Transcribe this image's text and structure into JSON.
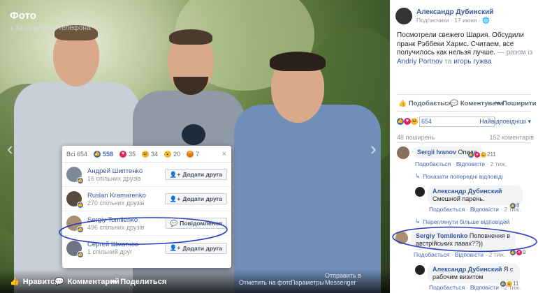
{
  "photo": {
    "title": "Фото",
    "subtitle": "з Загруженнях телефона",
    "bottom": {
      "like": "Нравится",
      "comment": "Комментарий",
      "share": "Поделиться",
      "links": [
        "Отметить на фото",
        "Параметры",
        "Отправить в Messenger"
      ]
    }
  },
  "reactions_popup": {
    "tabs": [
      {
        "label": "Всі 654",
        "icon": "",
        "active": false
      },
      {
        "label": "558",
        "icon": "like-icon",
        "active": true
      },
      {
        "label": "35",
        "icon": "love-icon",
        "active": false
      },
      {
        "label": "34",
        "icon": "haha-icon",
        "active": false
      },
      {
        "label": "20",
        "icon": "wow-icon",
        "active": false
      },
      {
        "label": "7",
        "icon": "angry-icon",
        "active": false
      }
    ],
    "close": "×",
    "people": [
      {
        "name": "Андрей Шиптенко",
        "mutual": "16 спільних друзів",
        "button": "Додати друга",
        "button_icon": "add-friend-icon"
      },
      {
        "name": "Ruslan Kramarenko",
        "mutual": "270 спільних друзів",
        "button": "Додати друга",
        "button_icon": "add-friend-icon"
      },
      {
        "name": "Sergiy Tomilenko",
        "mutual": "496 спільних друзів",
        "button": "Повідомлення",
        "button_icon": "messenger-icon"
      },
      {
        "name": "Сергей Шматков",
        "mutual": "1 спільний друг",
        "button": "Додати друга",
        "button_icon": "add-friend-icon"
      }
    ]
  },
  "post": {
    "author": "Александр Дубинский",
    "meta": "Подписчики · 17 июня · 🌐",
    "text_main": "Посмотрели свежего Шария. Обсудили пранк Рэббеки Хармс. Считаем, все получилось как нельзя лучше.",
    "text_with": " — разом із ",
    "tag1": "Andriy Portnov",
    "text_and": " та ",
    "tag2": "игорь гужва",
    "actions": [
      "Подобається",
      "Коментувати",
      "Поширити"
    ],
    "reaction_count": "654",
    "sort": "Найвідповідніші ▾",
    "shares": "48 поширень",
    "comments_count": "152 коментарів"
  },
  "comments": [
    {
      "name": "Sergii Ivanov",
      "text": "Опида.",
      "meta_like": "Подобається",
      "meta_reply": "Відповісти",
      "meta_time": "2 тиж.",
      "reactions": "211"
    },
    {
      "more": "Показати попередні відповіді"
    },
    {
      "name": "Александр Дубинский",
      "text": "Смешной парень.",
      "meta_like": "Подобається",
      "meta_reply": "Відповісти",
      "meta_time": "2 тиж.",
      "reactions": "8"
    },
    {
      "more": "Переглянути більше відповідей"
    },
    {
      "name": "Sergiy Tomilenko",
      "text": "Поповнення в австрійських лавах??))",
      "meta_like": "Подобається",
      "meta_reply": "Відповісти",
      "meta_time": "2 тиж.",
      "reactions": "9"
    },
    {
      "name": "Александр Дубинский",
      "text": "Я с рабочим визитом",
      "meta_like": "Подобається",
      "meta_reply": "Відповісти",
      "meta_time": "2 тиж.",
      "reactions": "11"
    }
  ],
  "colors": {
    "fb_blue": "#4267b2",
    "link": "#365899",
    "annotation": "#2b3fc4"
  }
}
